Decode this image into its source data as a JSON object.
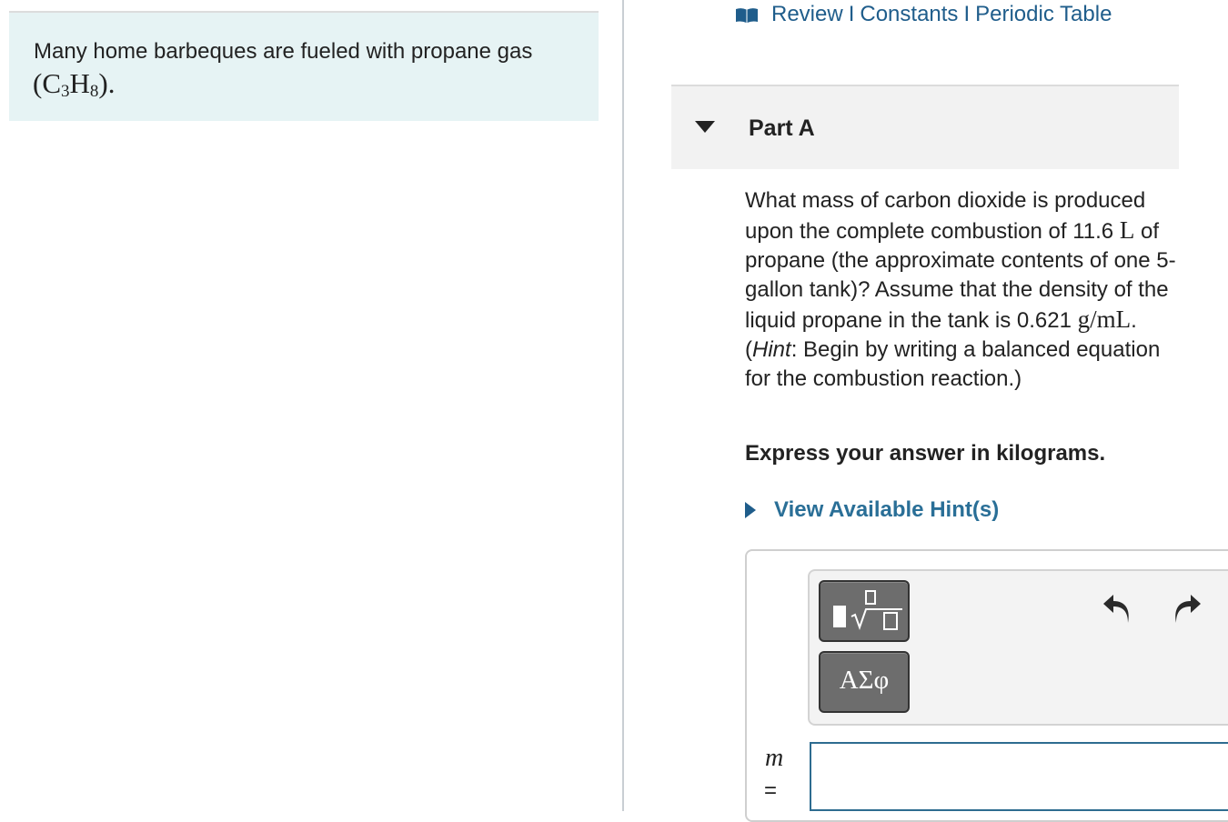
{
  "intro": {
    "text": "Many home barbeques are fueled with propane gas",
    "formula": {
      "open": "(",
      "c": "C",
      "c_sub": "3",
      "h": "H",
      "h_sub": "8",
      "close": ")."
    }
  },
  "top_links": {
    "review": "Review",
    "constants": "Constants",
    "periodic_table": "Periodic Table",
    "separator": "I"
  },
  "part": {
    "title": "Part A"
  },
  "question": {
    "seg1": "What mass of carbon dioxide is produced upon the complete combustion of 11.6 ",
    "unit1": "L",
    "seg2": " of propane (the approximate contents of one 5-gallon tank)? Assume that the density of the liquid propane in the tank is 0.621 ",
    "unit2": "g/mL",
    "seg3": ". (",
    "hint_word": "Hint",
    "seg4": ": Begin by writing a balanced equation for the combustion reaction.)"
  },
  "instruction": "Express your answer in kilograms.",
  "hints_link": "View Available Hint(s)",
  "toolbar": {
    "greek_label": "ΑΣφ"
  },
  "answer": {
    "variable": "m",
    "equals": "=",
    "value": ""
  },
  "colors": {
    "link": "#1f5d8b",
    "hint_link": "#2a6f97",
    "intro_bg": "#e6f3f4",
    "header_bg": "#f2f2f2",
    "input_border": "#2e6c90"
  }
}
